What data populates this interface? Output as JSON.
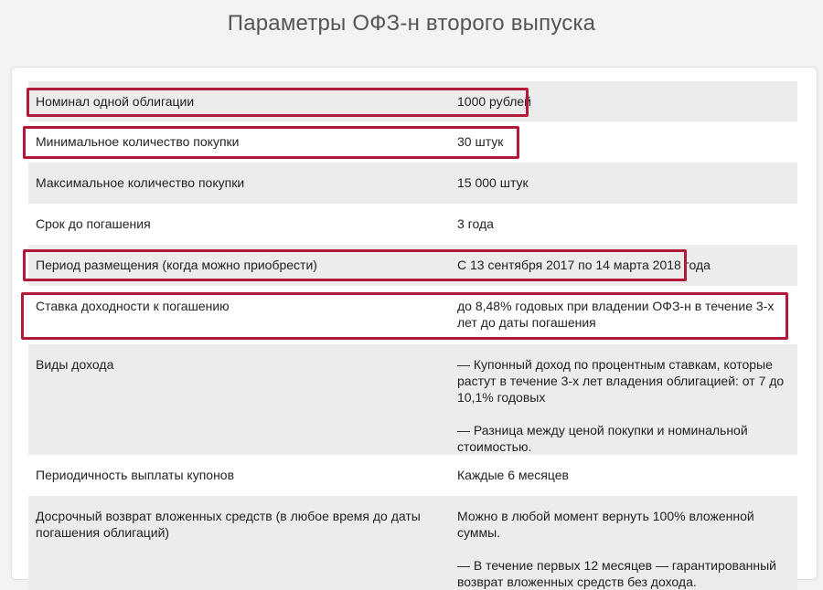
{
  "page": {
    "title": "Параметры ОФЗ-н второго выпуска"
  },
  "params": [
    {
      "label": "Номинал одной облигации",
      "value": [
        "1000 рублей"
      ]
    },
    {
      "label": "Минимальное количество покупки",
      "value": [
        "30 штук"
      ]
    },
    {
      "label": "Максимальное количество покупки",
      "value": [
        "15 000 штук"
      ]
    },
    {
      "label": "Срок до погашения",
      "value": [
        "3 года"
      ]
    },
    {
      "label": "Период размещения (когда можно приобрести)",
      "value": [
        "С 13 сентября 2017 по 14 марта 2018 года"
      ]
    },
    {
      "label": "Ставка доходности к погашению",
      "value": [
        "до 8,48% годовых при владении ОФЗ-н в течение 3-х лет до даты погашения"
      ]
    },
    {
      "label": "Виды дохода",
      "value": [
        "— Купонный доход по процентным ставкам, которые растут в течение 3-х лет владения облигацией: от 7 до 10,1% годовых",
        "— Разница между ценой покупки и номинальной стоимостью."
      ]
    },
    {
      "label": "Периодичность выплаты купонов",
      "value": [
        "Каждые 6 месяцев"
      ]
    },
    {
      "label": "Досрочный возврат вложенных средств (в любое время до даты погашения облигаций)",
      "value": [
        "Можно в любой момент вернуть 100% вложенной суммы.",
        "— В течение первых 12 месяцев — гарантированный возврат вложенных средств без дохода."
      ]
    }
  ],
  "colors": {
    "highlight": "#b0193a",
    "row_shade": "#ececec"
  }
}
